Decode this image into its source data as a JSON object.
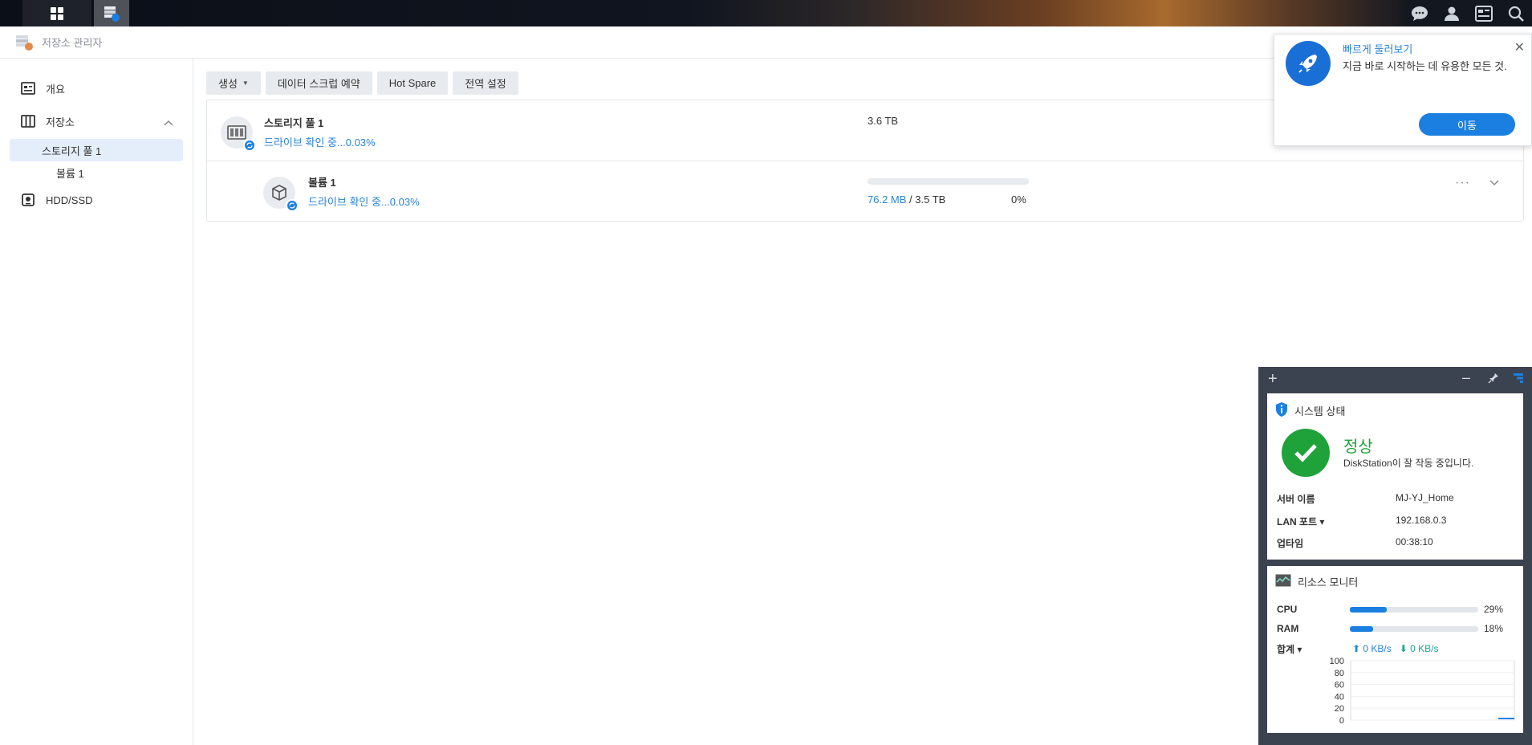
{
  "window": {
    "title": "저장소 관리자"
  },
  "sidebar": {
    "items": [
      {
        "label": "개요",
        "icon": "overview-icon"
      },
      {
        "label": "저장소",
        "icon": "storage-icon"
      },
      {
        "label": "스토리지 풀 1"
      },
      {
        "label": "볼륨 1"
      },
      {
        "label": "HDD/SSD",
        "icon": "hdd-icon"
      }
    ]
  },
  "toolbar": {
    "create_label": "생성",
    "scrub_label": "데이터 스크럽 예약",
    "hotspare_label": "Hot Spare",
    "global_label": "전역 설정"
  },
  "pool": {
    "name": "스토리지 풀 1",
    "status": "드라이브 확인 중...0.03%",
    "capacity": "3.6 TB"
  },
  "volume": {
    "name": "볼륨 1",
    "status": "드라이브 확인 중...0.03%",
    "used": "76.2 MB",
    "total": "/ 3.5 TB",
    "percent_label": "0%",
    "usage_fraction": 0.0
  },
  "tour": {
    "title": "빠르게 둘러보기",
    "body": "지금 바로 시작하는 데 유용한 모든 것.",
    "button": "이동"
  },
  "system_status": {
    "title": "시스템 상태",
    "state": "정상",
    "description": "DiskStation이 잘 작동 중입니다.",
    "rows": [
      {
        "label": "서버 이름",
        "value": "MJ-YJ_Home"
      },
      {
        "label": "LAN 포트 ▾",
        "value": "192.168.0.3"
      },
      {
        "label": "업타임",
        "value": "00:38:10"
      }
    ]
  },
  "resource_monitor": {
    "title": "리소스 모니터",
    "cpu": {
      "label": "CPU",
      "percent_label": "29%",
      "value": 29
    },
    "ram": {
      "label": "RAM",
      "percent_label": "18%",
      "value": 18
    },
    "net": {
      "label": "합계 ▾",
      "up": "0 KB/s",
      "down": "0 KB/s"
    }
  },
  "chart_data": {
    "type": "line",
    "y_ticks": [
      "100",
      "80",
      "60",
      "40",
      "20",
      "0"
    ],
    "ylim": [
      0,
      100
    ],
    "series": [
      {
        "values": [
          0,
          0,
          0,
          0,
          0,
          0,
          0,
          0,
          0,
          0
        ]
      }
    ]
  },
  "colors": {
    "accent": "#1a7fe0",
    "ok": "#1fa23a",
    "link": "#2a83d6"
  }
}
